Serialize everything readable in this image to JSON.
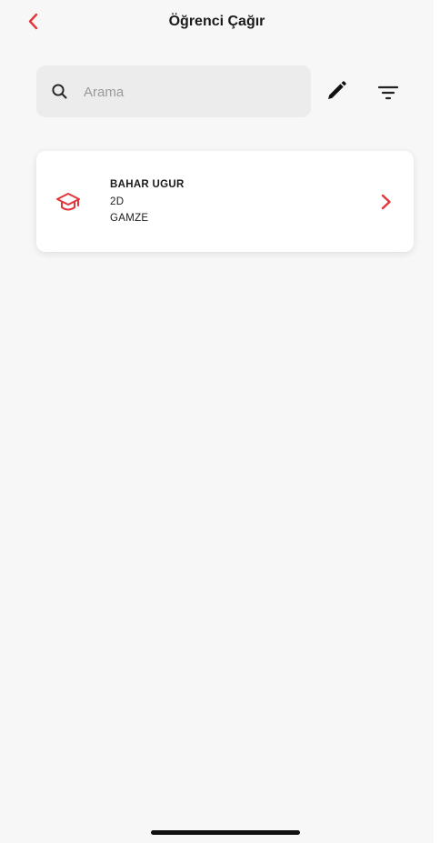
{
  "colors": {
    "accent": "#e0363b",
    "background": "#f7f7f7",
    "card_background": "#ffffff",
    "search_background": "#ececec",
    "text": "#1a1a1a"
  },
  "header": {
    "title": "Öğrenci Çağır",
    "back_icon": "chevron-left-icon"
  },
  "search": {
    "placeholder": "Arama",
    "value": "",
    "icon": "search-icon"
  },
  "toolbar": {
    "edit_icon": "pencil-icon",
    "filter_icon": "filter-icon"
  },
  "students": [
    {
      "name": "BAHAR UGUR",
      "class": "2D",
      "teacher": "GAMZE",
      "icon": "graduation-cap-icon"
    }
  ]
}
